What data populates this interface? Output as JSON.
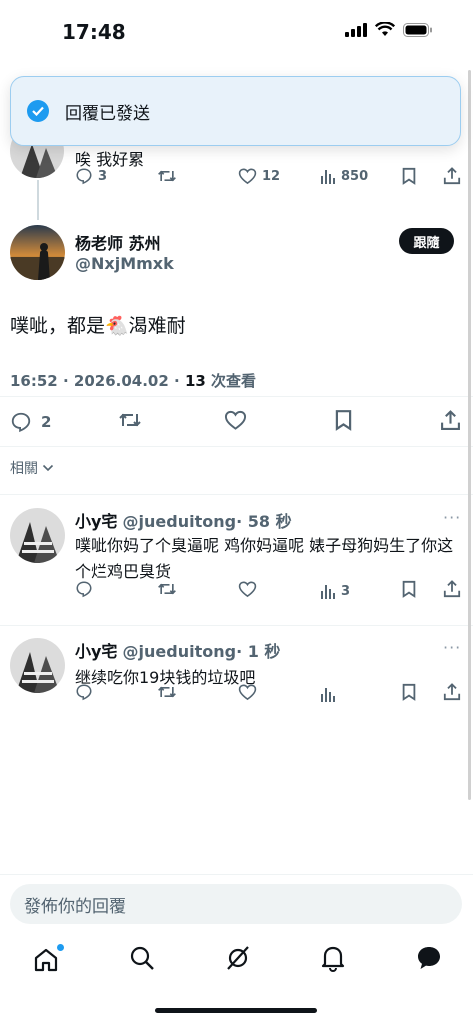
{
  "status_bar": {
    "time": "17:48"
  },
  "toast": {
    "text": "回覆已發送",
    "icon": "check-circle-icon"
  },
  "parent_tweet": {
    "text": "唉 我好累",
    "replies": "3",
    "likes": "12",
    "views": "850"
  },
  "main_tweet": {
    "author_name": "杨老师 苏州",
    "author_handle": "@NxjMmxk",
    "follow_label": "跟隨",
    "text": "噗呲，都是🐔渴难耐",
    "time": "16:52 · 2026.04.02 · ",
    "views_count": "13",
    "views_label": " 次查看",
    "replies": "2"
  },
  "related_label": "相關",
  "replies": [
    {
      "name": "小y宅",
      "handle": "@jueduitong",
      "time": "· 58 秒",
      "text": "噗呲你妈了个臭逼呢 鸡你妈逼呢 婊子母狗妈生了你这个烂鸡巴臭货",
      "views": "3"
    },
    {
      "name": "小y宅",
      "handle": "@jueduitong",
      "time": "· 1 秒",
      "text": "继续吃你19块钱的垃圾吧",
      "views": ""
    }
  ],
  "more_label": "···",
  "reply_composer": {
    "placeholder": "發佈你的回覆"
  },
  "tabs": [
    "home-icon",
    "search-icon",
    "grok-icon",
    "bell-icon",
    "messages-icon"
  ],
  "colors": {
    "accent": "#1d9bf0",
    "text": "#0f1419",
    "muted": "#536471"
  }
}
